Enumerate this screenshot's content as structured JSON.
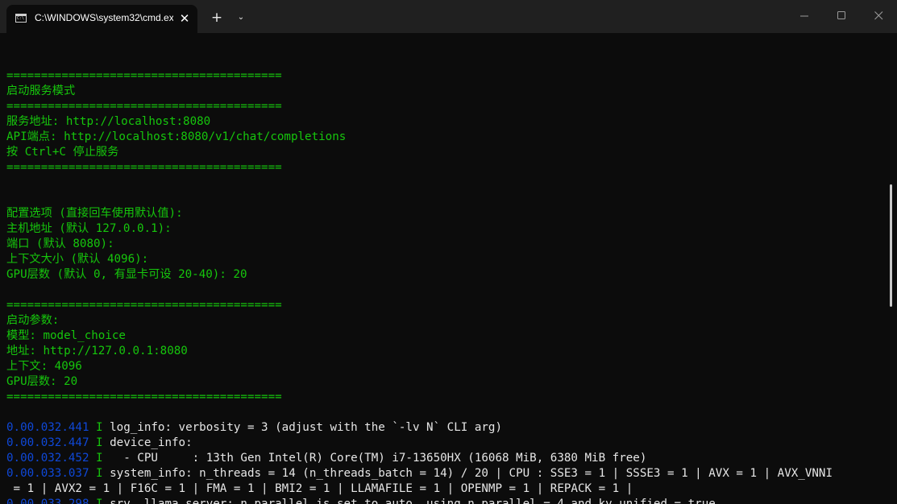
{
  "window": {
    "tab_title": "C:\\WINDOWS\\system32\\cmd.exe",
    "tab_close": "✕",
    "new_tab": "+",
    "dropdown": "⌄"
  },
  "terminal": {
    "lines": [
      "",
      "========================================",
      "启动服务模式",
      "========================================",
      "服务地址: http://localhost:8080",
      "API端点: http://localhost:8080/v1/chat/completions",
      "按 Ctrl+C 停止服务",
      "========================================",
      "",
      "",
      "配置选项 (直接回车使用默认值):",
      "主机地址 (默认 127.0.0.1):",
      "端口 (默认 8080):",
      "上下文大小 (默认 4096):",
      "GPU层数 (默认 0, 有显卡可设 20-40): 20",
      "",
      "========================================",
      "启动参数:",
      "模型: model_choice",
      "地址: http://127.0.0.1:8080",
      "上下文: 4096",
      "GPU层数: 20",
      "========================================",
      ""
    ],
    "logs": [
      {
        "ts": "0.00.032.441",
        "lvl": "I",
        "msg": "log_info: verbosity = 3 (adjust with the `-lv N` CLI arg)"
      },
      {
        "ts": "0.00.032.447",
        "lvl": "I",
        "msg": "device_info:"
      },
      {
        "ts": "0.00.032.452",
        "lvl": "I",
        "msg": "  - CPU     : 13th Gen Intel(R) Core(TM) i7-13650HX (16068 MiB, 6380 MiB free)"
      },
      {
        "ts": "0.00.033.037",
        "lvl": "I",
        "msg": "system_info: n_threads = 14 (n_threads_batch = 14) / 20 | CPU : SSE3 = 1 | SSSE3 = 1 | AVX = 1 | AVX_VNNI"
      },
      {
        "ts": "",
        "lvl": "",
        "msg": " = 1 | AVX2 = 1 | F16C = 1 | FMA = 1 | BMI2 = 1 | LLAMAFILE = 1 | OPENMP = 1 | REPACK = 1 |"
      },
      {
        "ts": "0.00.033.298",
        "lvl": "I",
        "msg": "srv  llama_server: n_parallel is set to auto, using n_parallel = 4 and kv_unified = true"
      }
    ]
  }
}
